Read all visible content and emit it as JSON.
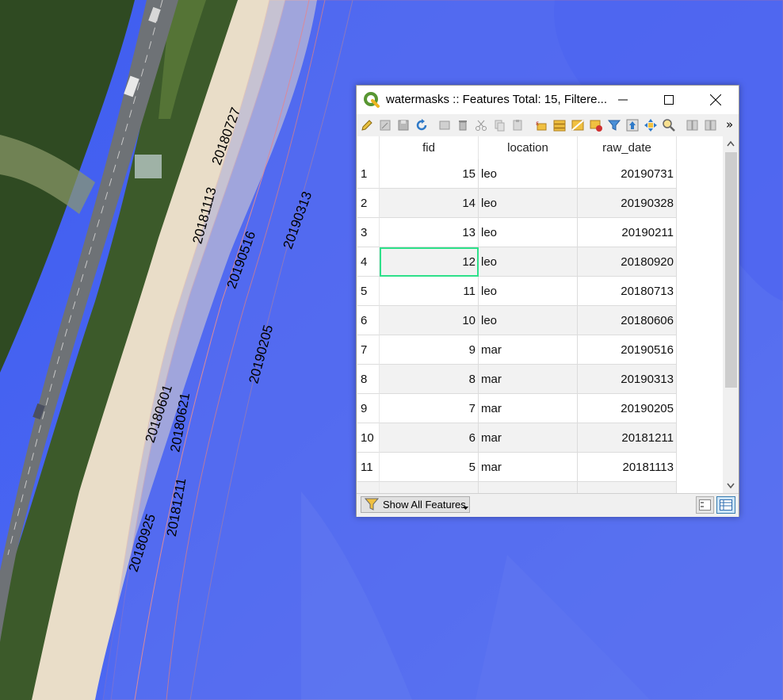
{
  "map": {
    "labels": [
      "20180727",
      "20181113",
      "20190313",
      "20190516",
      "20190205",
      "20180601",
      "20180621",
      "20181211",
      "20180925"
    ]
  },
  "window": {
    "title": "watermasks :: Features Total: 15, Filtere...",
    "table": {
      "columns": [
        "fid",
        "location",
        "raw_date"
      ],
      "rows": [
        {
          "num": "1",
          "fid": "15",
          "location": "leo",
          "raw_date": "20190731"
        },
        {
          "num": "2",
          "fid": "14",
          "location": "leo",
          "raw_date": "20190328"
        },
        {
          "num": "3",
          "fid": "13",
          "location": "leo",
          "raw_date": "20190211"
        },
        {
          "num": "4",
          "fid": "12",
          "location": "leo",
          "raw_date": "20180920"
        },
        {
          "num": "5",
          "fid": "11",
          "location": "leo",
          "raw_date": "20180713"
        },
        {
          "num": "6",
          "fid": "10",
          "location": "leo",
          "raw_date": "20180606"
        },
        {
          "num": "7",
          "fid": "9",
          "location": "mar",
          "raw_date": "20190516"
        },
        {
          "num": "8",
          "fid": "8",
          "location": "mar",
          "raw_date": "20190313"
        },
        {
          "num": "9",
          "fid": "7",
          "location": "mar",
          "raw_date": "20190205"
        },
        {
          "num": "10",
          "fid": "6",
          "location": "mar",
          "raw_date": "20181211"
        },
        {
          "num": "11",
          "fid": "5",
          "location": "mar",
          "raw_date": "20181113"
        }
      ],
      "selected_row": 3
    },
    "filter_button_label": "Show All Features",
    "overflow_label": "»",
    "colors": {
      "accent": "#589632",
      "selection": "#2ee08a",
      "water": "#4f68f0"
    }
  }
}
